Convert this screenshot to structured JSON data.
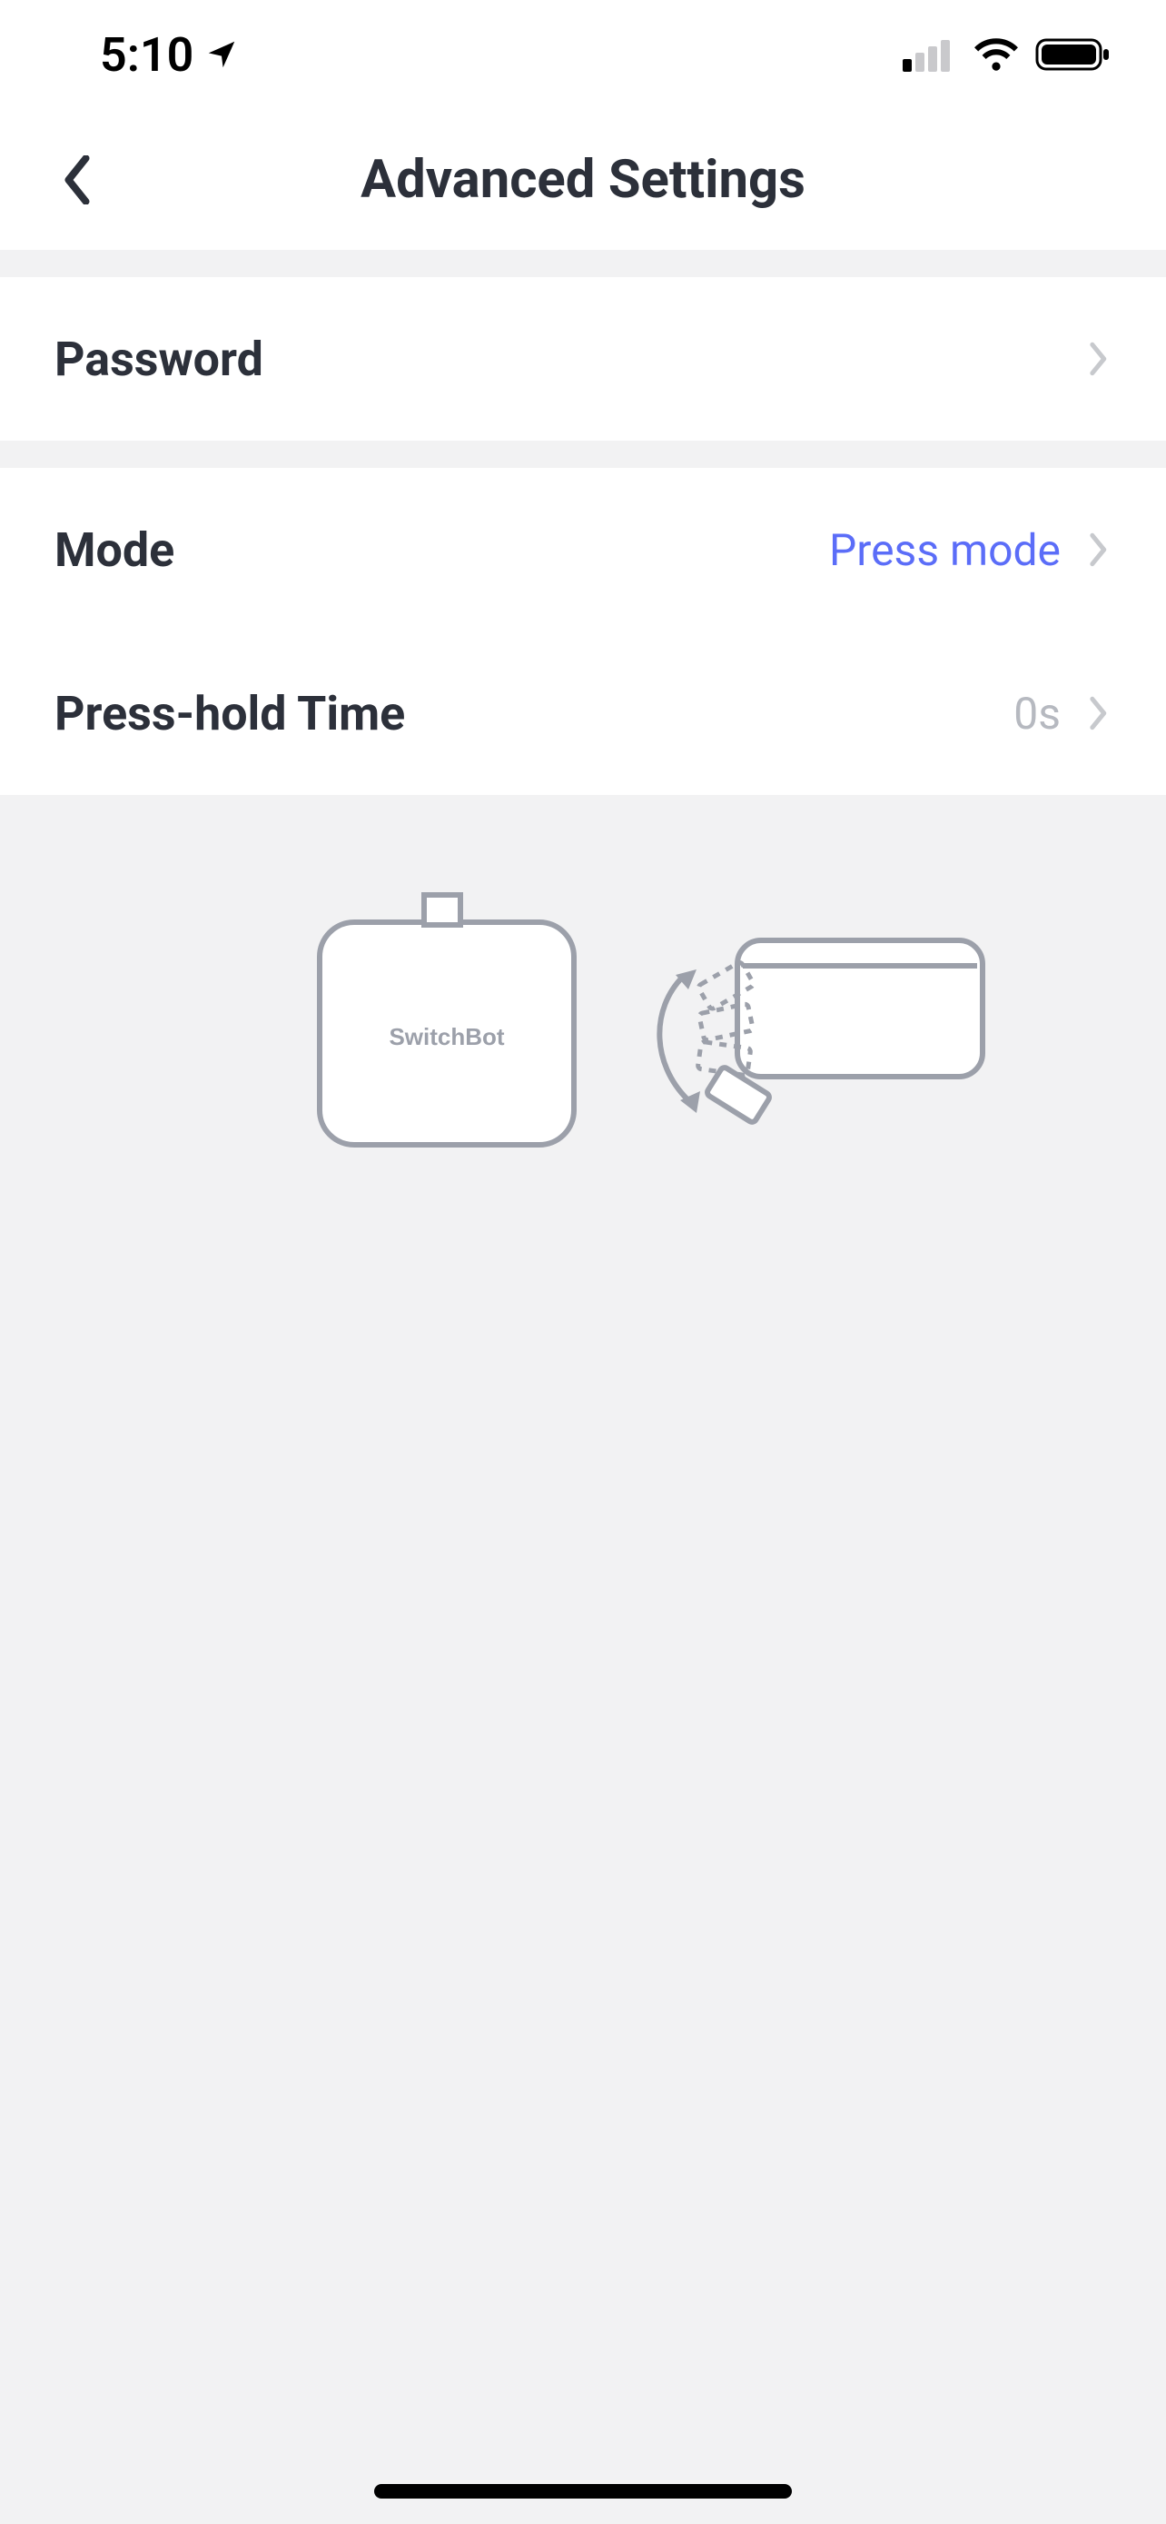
{
  "status_bar": {
    "time": "5:10"
  },
  "header": {
    "title": "Advanced Settings"
  },
  "rows": {
    "password": {
      "label": "Password"
    },
    "mode": {
      "label": "Mode",
      "value": "Press mode"
    },
    "press_hold_time": {
      "label": "Press-hold Time",
      "value": "0s"
    }
  },
  "illustration": {
    "device_label": "SwitchBot"
  }
}
